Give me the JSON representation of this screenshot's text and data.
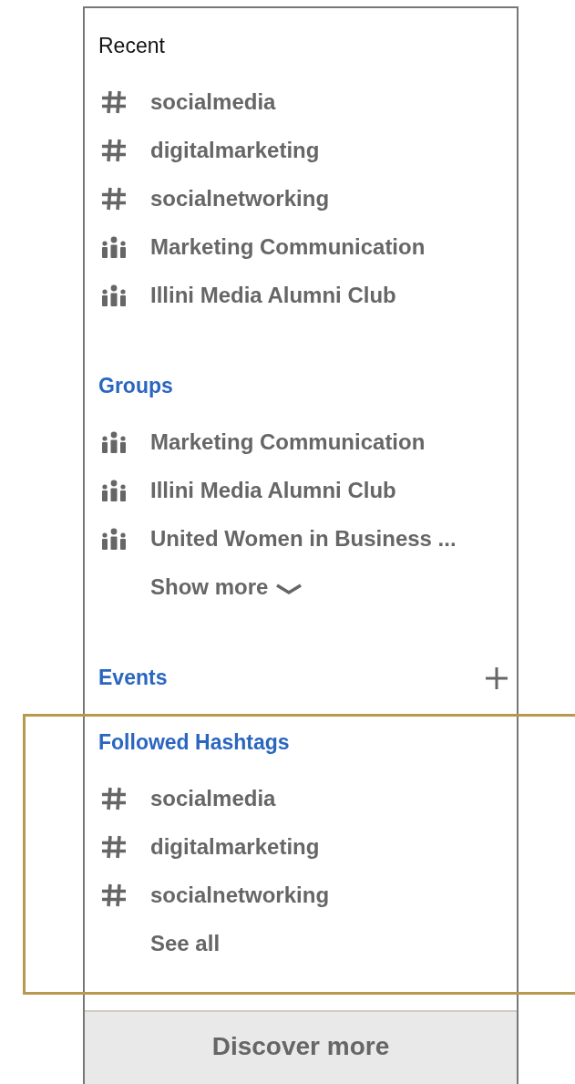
{
  "sections": [
    {
      "title": "Recent",
      "kind": "plain",
      "addable": false,
      "highlighted": false,
      "items": [
        {
          "label": "socialmedia",
          "kind": "hashtag"
        },
        {
          "label": "digitalmarketing",
          "kind": "hashtag"
        },
        {
          "label": "socialnetworking",
          "kind": "hashtag"
        },
        {
          "label": "Marketing Communication",
          "kind": "group"
        },
        {
          "label": "Illini Media Alumni Club",
          "kind": "group"
        }
      ]
    },
    {
      "title": "Groups",
      "kind": "link",
      "addable": false,
      "highlighted": false,
      "items": [
        {
          "label": "Marketing Communication",
          "kind": "group"
        },
        {
          "label": "Illini Media Alumni Club",
          "kind": "group"
        },
        {
          "label": "United Women in Business ...",
          "kind": "group"
        }
      ],
      "more": {
        "label": "Show more",
        "kind": "expand"
      }
    },
    {
      "title": "Events",
      "kind": "link",
      "addable": true,
      "highlighted": false
    },
    {
      "title": "Followed Hashtags",
      "kind": "link",
      "addable": false,
      "highlighted": true,
      "items": [
        {
          "label": "socialmedia",
          "kind": "hashtag"
        },
        {
          "label": "digitalmarketing",
          "kind": "hashtag"
        },
        {
          "label": "socialnetworking",
          "kind": "hashtag"
        }
      ],
      "more": {
        "label": "See all",
        "kind": "plain"
      }
    }
  ],
  "footer_button": "Discover more"
}
